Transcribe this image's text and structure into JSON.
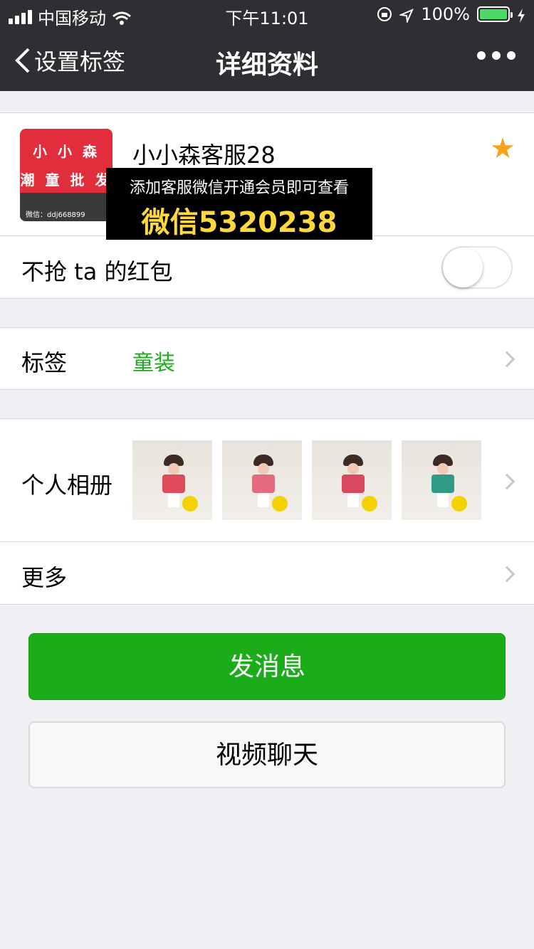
{
  "status_bar": {
    "carrier": "中国移动",
    "time": "下午11:01",
    "battery": "100%",
    "battery_color": "#4cd964"
  },
  "nav": {
    "back_label": "设置标签",
    "title": "详细资料",
    "more_icon": "more-dots-icon"
  },
  "profile": {
    "name": "小小森客服28",
    "avatar_lines": [
      "小 小 森",
      "潮 童 批 发"
    ],
    "avatar_wechat": "微信：ddj668899",
    "starred": true,
    "star_color": "#f7a11a"
  },
  "overlay_ad": {
    "line1": "添加客服微信开通会员即可查看",
    "line2": "微信5320238",
    "text_color": "#ffd93b"
  },
  "red_packet_row": {
    "label": "不抢 ta 的红包",
    "toggle_on": false
  },
  "tags_row": {
    "label": "标签",
    "value": "童装",
    "value_color": "#1aad19"
  },
  "album_row": {
    "label": "个人相册",
    "thumbnail_count": 4
  },
  "more_row": {
    "label": "更多"
  },
  "buttons": {
    "send_message": "发消息",
    "video_chat": "视频聊天",
    "primary_color": "#1aad19"
  }
}
